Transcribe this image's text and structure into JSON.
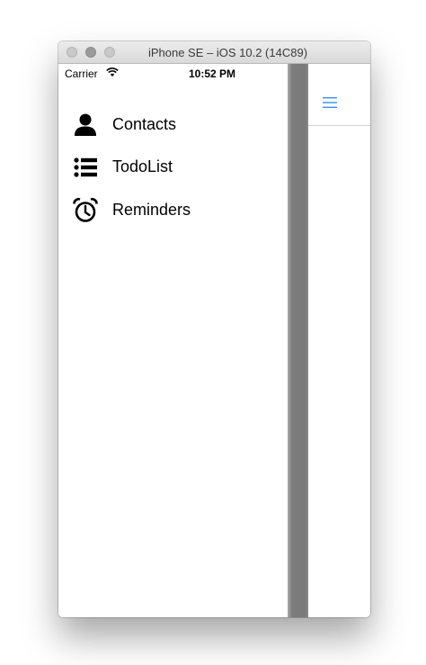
{
  "window": {
    "title": "iPhone SE – iOS 10.2 (14C89)"
  },
  "statusbar": {
    "carrier": "Carrier",
    "time": "10:52 PM"
  },
  "menu": {
    "items": [
      {
        "label": "Contacts",
        "icon": "person-icon"
      },
      {
        "label": "TodoList",
        "icon": "list-icon"
      },
      {
        "label": "Reminders",
        "icon": "alarm-clock-icon"
      }
    ]
  },
  "navbar": {
    "menu_button_icon": "hamburger-menu-icon"
  },
  "colors": {
    "accent": "#3b8ff0",
    "overlay_shadow": "#7c7c7c"
  }
}
